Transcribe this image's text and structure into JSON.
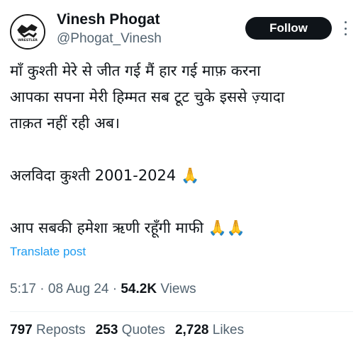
{
  "tweet": {
    "author_name": "Vinesh Phogat",
    "author_handle": "@Phogat_Vinesh",
    "follow_label": "Follow",
    "avatar_text": "WRESTLER",
    "lines": [
      "माँ कुश्ती मेरे से जीत गई मैं हार गई माफ़ करना",
      "आपका सपना मेरी हिम्मत सब टूट चुके इससे ज़्यादा",
      "ताक़त नहीं रही अब।",
      "",
      "अलविदा कुश्ती 2001-2024 🙏",
      "",
      "आप सबकी हमेशा ऋणी रहूँगी माफी 🙏🙏"
    ],
    "translate_label": "Translate post",
    "time": "5:17",
    "date": "08 Aug 24",
    "separator": "·",
    "views_count": "54.2K",
    "views_label": "Views"
  },
  "stats": {
    "reposts_count": "797",
    "reposts_label": "Reposts",
    "quotes_count": "253",
    "quotes_label": "Quotes",
    "likes_count": "2,728",
    "likes_label": "Likes"
  }
}
